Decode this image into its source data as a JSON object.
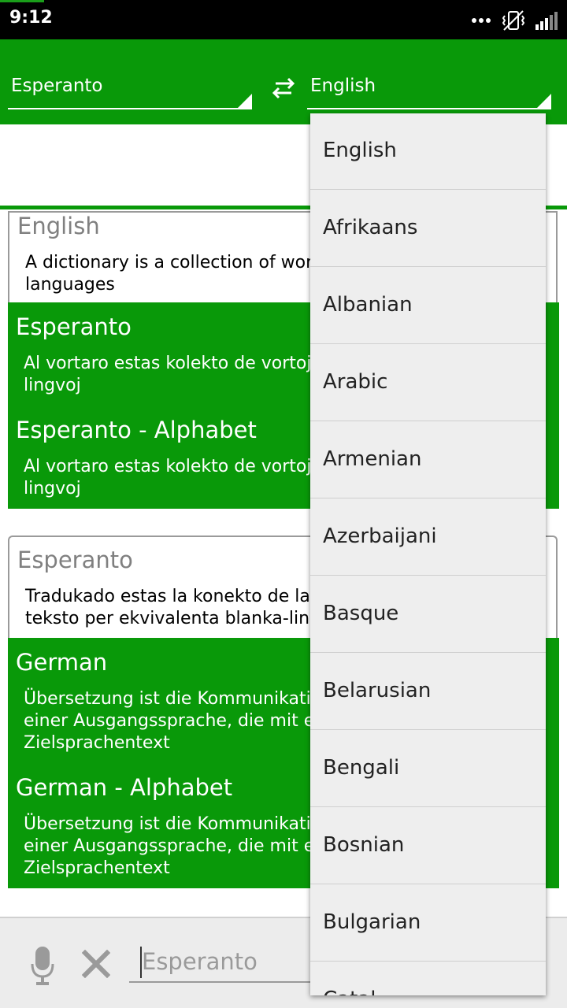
{
  "status_bar": {
    "time": "9:12"
  },
  "toolbar": {
    "source_language": "Esperanto",
    "target_language": "English"
  },
  "cards": [
    {
      "source_title": "English",
      "source_text_line1": "A dictionary is a collection of wor",
      "source_text_line2": "languages",
      "translations": [
        {
          "title": "Esperanto",
          "line1": "Al vortaro estas kolekto de vortoj",
          "line2": "lingvoj"
        },
        {
          "title": "Esperanto - Alphabet",
          "line1": "Al vortaro estas kolekto de vortoj",
          "line2": "lingvoj"
        }
      ]
    },
    {
      "source_title": "Esperanto",
      "source_text_line1": "Tradukado estas la konekto de la",
      "source_text_line2": "teksto per ekvivalenta blanka-lingv",
      "translations": [
        {
          "title": "German",
          "line1": "Übersetzung ist die Kommunikatio",
          "line2": "einer Ausgangssprache, die mit e",
          "line3": "Zielsprachentext"
        },
        {
          "title": "German - Alphabet",
          "line1": "Übersetzung ist die Kommunikatio",
          "line2": "einer Ausgangssprache, die mit e",
          "line3": "Zielsprachentext"
        }
      ]
    }
  ],
  "bottom_bar": {
    "input_placeholder": "Esperanto"
  },
  "dropdown": {
    "options": [
      "English",
      "Afrikaans",
      "Albanian",
      "Arabic",
      "Armenian",
      "Azerbaijani",
      "Basque",
      "Belarusian",
      "Bengali",
      "Bosnian",
      "Bulgarian",
      "Catal"
    ]
  },
  "colors": {
    "accent_green": "#099909",
    "dropdown_bg": "#eeeeee"
  },
  "icons": [
    "more-icon",
    "vibrate-icon",
    "signal-icon",
    "swap-icon",
    "microphone-icon",
    "clear-icon"
  ]
}
